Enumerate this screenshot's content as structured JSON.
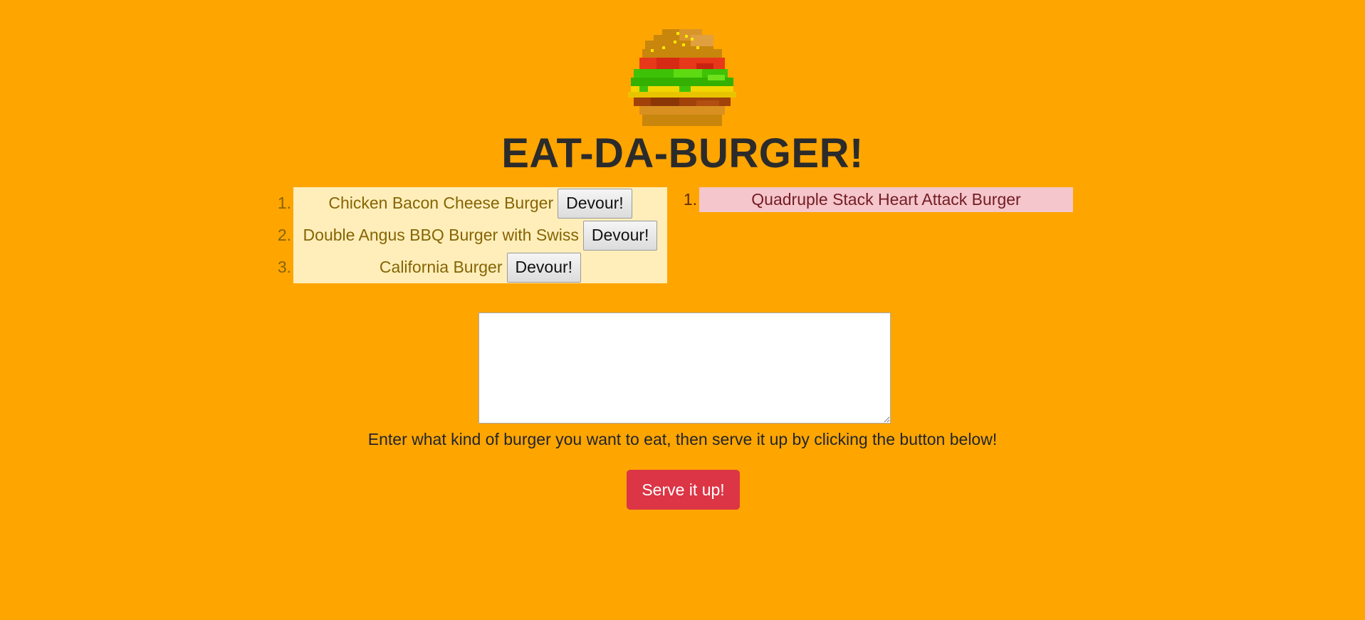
{
  "header": {
    "logo_icon": "pixel-burger-icon",
    "title": "EAT-DA-BURGER!"
  },
  "uneaten_burgers": [
    {
      "number": "1.",
      "name": "Chicken Bacon Cheese Burger",
      "button_label": "Devour!"
    },
    {
      "number": "2.",
      "name": "Double Angus BBQ Burger with Swiss",
      "button_label": "Devour!"
    },
    {
      "number": "3.",
      "name": "California Burger",
      "button_label": "Devour!"
    }
  ],
  "devoured_burgers": [
    {
      "number": "1.",
      "name": "Quadruple Stack Heart Attack Burger"
    }
  ],
  "form": {
    "input_value": "",
    "instructions": "Enter what kind of burger you want to eat, then serve it up by clicking the button below!",
    "submit_label": "Serve it up!"
  },
  "colors": {
    "page_background": "#FFA500",
    "uneaten_list_background": "#FFEEBA",
    "devoured_list_background": "#F5C6CB",
    "serve_button": "#DC3545"
  }
}
